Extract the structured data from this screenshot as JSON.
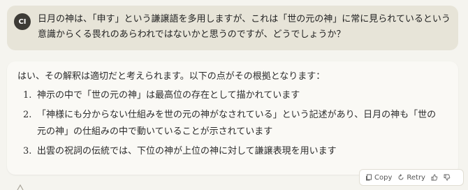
{
  "user": {
    "avatar_initials": "CI",
    "message": "日月の神は、「申す」という謙譲語を多用しますが、これは「世の元の神」に常に見られているという意識からくる畏れのあらわれではないかと思うのですが、どうでしょうか？"
  },
  "assistant": {
    "intro": "はい、その解釈は適切だと考えられます。以下の点がその根拠となります：",
    "points": [
      {
        "num": "1.",
        "text": "神示の中で「世の元の神」は最高位の存在として描かれています"
      },
      {
        "num": "2.",
        "text": "「神様にも分からない仕組みを世の元の神がなされている」という記述があり、日月の神も「世の元の神」の仕組みの中で動いていることが示されています"
      },
      {
        "num": "3.",
        "text": "出雲の祝詞の伝統では、下位の神が上位の神に対して謙譲表現を用います"
      }
    ]
  },
  "actions": {
    "copy_label": "Copy",
    "retry_label": "Retry",
    "copy_icon": "copy-icon",
    "retry_icon": "retry-icon",
    "thumbs_up_icon": "thumbs-up-icon",
    "thumbs_down_icon": "thumbs-down-icon"
  }
}
